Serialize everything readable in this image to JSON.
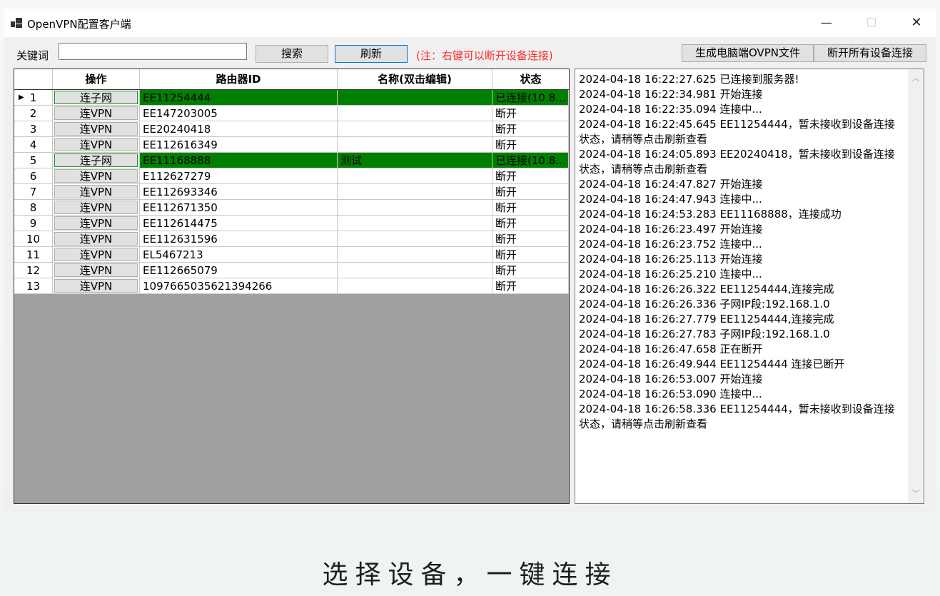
{
  "window": {
    "title": "OpenVPN配置客户端",
    "controls": {
      "minimize": "—",
      "maximize": "☐",
      "close": "✕"
    }
  },
  "toolbar": {
    "keyword_label": "关键词",
    "keyword_value": "",
    "search_label": "搜索",
    "refresh_label": "刷新",
    "note": "(注：右键可以断开设备连接)",
    "generate_label": "生成电脑端OVPN文件",
    "disconnect_all_label": "断开所有设备连接"
  },
  "grid": {
    "columns": [
      "操作",
      "路由器ID",
      "名称(双击编辑)",
      "状态"
    ],
    "rows": [
      {
        "num": "1",
        "action": "连子网",
        "id": "EE11254444",
        "name": "",
        "status": "已连接(10.8...",
        "selected": true,
        "current": true
      },
      {
        "num": "2",
        "action": "连VPN",
        "id": "EE147203005",
        "name": "",
        "status": "断开"
      },
      {
        "num": "3",
        "action": "连VPN",
        "id": "EE20240418",
        "name": "",
        "status": "断开"
      },
      {
        "num": "4",
        "action": "连VPN",
        "id": "EE112616349",
        "name": "",
        "status": "断开"
      },
      {
        "num": "5",
        "action": "连子网",
        "id": "EE11168888",
        "name": "测试",
        "status": "已连接(10.8...",
        "selected": true
      },
      {
        "num": "6",
        "action": "连VPN",
        "id": "E112627279",
        "name": "",
        "status": "断开"
      },
      {
        "num": "7",
        "action": "连VPN",
        "id": "EE112693346",
        "name": "",
        "status": "断开"
      },
      {
        "num": "8",
        "action": "连VPN",
        "id": "EE112671350",
        "name": "",
        "status": "断开"
      },
      {
        "num": "9",
        "action": "连VPN",
        "id": "EE112614475",
        "name": "",
        "status": "断开"
      },
      {
        "num": "10",
        "action": "连VPN",
        "id": "EE112631596",
        "name": "",
        "status": "断开"
      },
      {
        "num": "11",
        "action": "连VPN",
        "id": "EL5467213",
        "name": "",
        "status": "断开"
      },
      {
        "num": "12",
        "action": "连VPN",
        "id": "EE112665079",
        "name": "",
        "status": "断开"
      },
      {
        "num": "13",
        "action": "连VPN",
        "id": "1097665035621394266",
        "name": "",
        "status": "断开"
      }
    ]
  },
  "log": [
    "2024-04-18 16:22:27.625 已连接到服务器!",
    "2024-04-18 16:22:34.981 开始连接",
    "2024-04-18 16:22:35.094 连接中...",
    "2024-04-18 16:22:45.645 EE11254444，暂未接收到设备连接状态，请稍等点击刷新查看",
    "2024-04-18 16:24:05.893 EE20240418，暂未接收到设备连接状态，请稍等点击刷新查看",
    "2024-04-18 16:24:47.827 开始连接",
    "2024-04-18 16:24:47.943 连接中...",
    "2024-04-18 16:24:53.283 EE11168888，连接成功",
    "2024-04-18 16:26:23.497 开始连接",
    "2024-04-18 16:26:23.752 连接中...",
    "2024-04-18 16:26:25.113 开始连接",
    "2024-04-18 16:26:25.210 连接中...",
    "2024-04-18 16:26:26.322 EE11254444,连接完成",
    "2024-04-18 16:26:26.336 子网IP段:192.168.1.0",
    "2024-04-18 16:26:27.779 EE11254444,连接完成",
    "2024-04-18 16:26:27.783 子网IP段:192.168.1.0",
    "2024-04-18 16:26:47.658 正在断开",
    "2024-04-18 16:26:49.944 EE11254444 连接已断开",
    "2024-04-18 16:26:53.007 开始连接",
    "2024-04-18 16:26:53.090 连接中...",
    "2024-04-18 16:26:58.336 EE11254444，暂未接收到设备连接状态，请稍等点击刷新查看"
  ],
  "caption": "选择设备，一键连接",
  "colors": {
    "selected_row": "#008000",
    "note": "#ff2a2a",
    "grid_empty": "#a0a0a0"
  },
  "icons": {
    "row_marker": "▶",
    "scroll_up": "︿",
    "scroll_down": "﹀"
  }
}
